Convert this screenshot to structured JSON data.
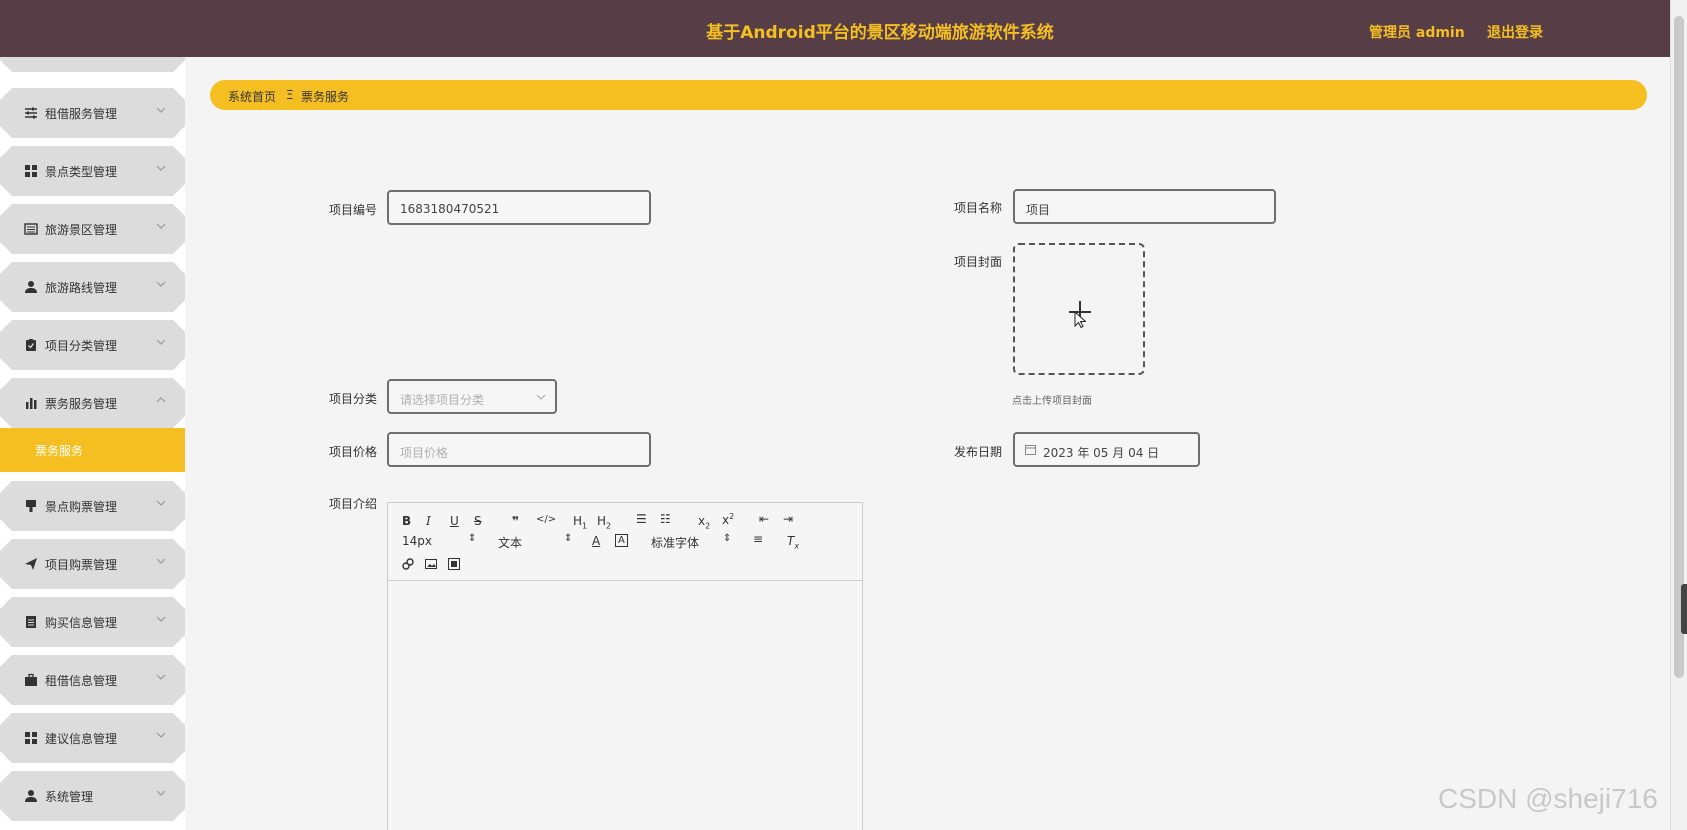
{
  "header": {
    "title": "基于Android平台的景区移动端旅游软件系统",
    "user_label": "管理员 admin",
    "logout": "退出登录"
  },
  "sidebar": {
    "items": [
      {
        "label": "租借服务管理",
        "icon": "sliders-icon"
      },
      {
        "label": "景点类型管理",
        "icon": "grid-icon"
      },
      {
        "label": "旅游景区管理",
        "icon": "list-icon"
      },
      {
        "label": "旅游路线管理",
        "icon": "user-icon"
      },
      {
        "label": "项目分类管理",
        "icon": "clipboard-icon"
      },
      {
        "label": "票务服务管理",
        "icon": "bar-chart-icon"
      },
      {
        "label": "景点购票管理",
        "icon": "bookmark-icon"
      },
      {
        "label": "项目购票管理",
        "icon": "send-icon"
      },
      {
        "label": "购买信息管理",
        "icon": "document-icon"
      },
      {
        "label": "租借信息管理",
        "icon": "briefcase-icon"
      },
      {
        "label": "建议信息管理",
        "icon": "grid-icon"
      },
      {
        "label": "系统管理",
        "icon": "user-icon"
      }
    ],
    "active_sub": "票务服务"
  },
  "breadcrumb": {
    "home": "系统首页",
    "separator": "Ξ",
    "current": "票务服务"
  },
  "form": {
    "item_no": {
      "label": "项目编号",
      "value": "1683180470521"
    },
    "item_name": {
      "label": "项目名称",
      "value": "项目"
    },
    "cover": {
      "label": "项目封面",
      "hint": "点击上传项目封面"
    },
    "category": {
      "label": "项目分类",
      "placeholder": "请选择项目分类"
    },
    "price": {
      "label": "项目价格",
      "placeholder": "项目价格"
    },
    "publish_date": {
      "label": "发布日期",
      "value": "2023 年 05 月 04 日"
    },
    "intro": {
      "label": "项目介绍"
    }
  },
  "editor": {
    "font_size": "14px",
    "text_style": "文本",
    "font_family": "标准字体"
  },
  "watermark": "CSDN @sheji716"
}
